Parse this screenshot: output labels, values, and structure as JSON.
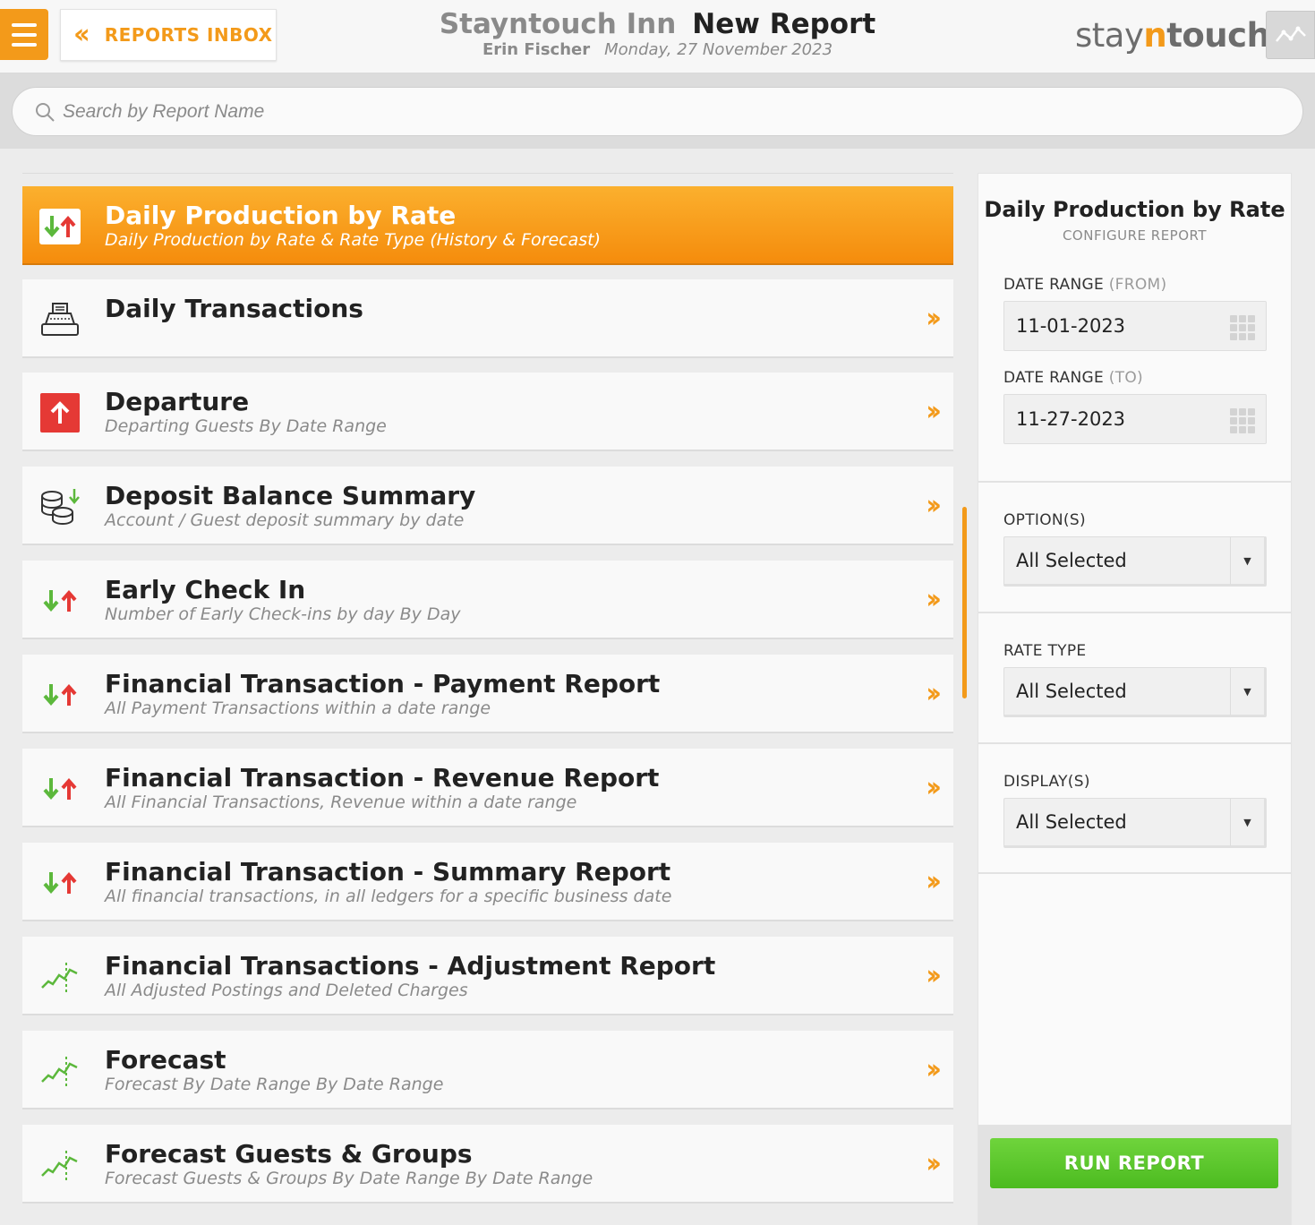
{
  "header": {
    "back_label": "REPORTS INBOX",
    "hotel_name": "Stayntouch Inn",
    "page_title": "New Report",
    "user_name": "Erin Fischer",
    "date": "Monday, 27 November 2023",
    "logo": {
      "part1": "stay",
      "part2": "n",
      "part3": "touch"
    }
  },
  "search": {
    "placeholder": "Search by Report Name"
  },
  "reports": [
    {
      "name": "Daily Production by Rate",
      "desc": "Daily Production by Rate & Rate Type (History & Forecast)",
      "icon": "arrows-icon",
      "active": true
    },
    {
      "name": "Daily Transactions",
      "desc": "",
      "icon": "cash-register-icon",
      "active": false
    },
    {
      "name": "Departure",
      "desc": "Departing Guests By Date Range",
      "icon": "departure-icon",
      "active": false
    },
    {
      "name": "Deposit Balance Summary",
      "desc": "Account / Guest deposit summary by date",
      "icon": "coins-icon",
      "active": false
    },
    {
      "name": "Early Check In",
      "desc": "Number of Early Check-ins by day By Day",
      "icon": "arrows-icon",
      "active": false
    },
    {
      "name": "Financial Transaction - Payment Report",
      "desc": "All Payment Transactions within a date range",
      "icon": "arrows-icon",
      "active": false
    },
    {
      "name": "Financial Transaction - Revenue Report",
      "desc": "All Financial Transactions, Revenue within a date range",
      "icon": "arrows-icon",
      "active": false
    },
    {
      "name": "Financial Transaction - Summary Report",
      "desc": "All financial transactions, in all ledgers for a specific business date",
      "icon": "arrows-icon",
      "active": false
    },
    {
      "name": "Financial Transactions - Adjustment Report",
      "desc": "All Adjusted Postings and Deleted Charges",
      "icon": "trend-icon",
      "active": false
    },
    {
      "name": "Forecast",
      "desc": "Forecast By Date Range By Date Range",
      "icon": "trend-icon",
      "active": false
    },
    {
      "name": "Forecast Guests & Groups",
      "desc": "Forecast Guests & Groups By Date Range By Date Range",
      "icon": "trend-icon",
      "active": false
    }
  ],
  "panel": {
    "title": "Daily Production by Rate",
    "subtitle": "CONFIGURE REPORT",
    "date_from_label": "DATE RANGE",
    "date_from_hint": "(FROM)",
    "date_from": "11-01-2023",
    "date_to_label": "DATE RANGE",
    "date_to_hint": "(TO)",
    "date_to": "11-27-2023",
    "options_label": "OPTION(S)",
    "options_value": "All Selected",
    "rate_type_label": "RATE TYPE",
    "rate_type_value": "All Selected",
    "display_label": "DISPLAY(S)",
    "display_value": "All Selected",
    "run_label": "RUN REPORT"
  },
  "colors": {
    "accent": "#f39a1a",
    "run": "#5cc72c",
    "up": "#e53935",
    "down": "#5cb83c"
  }
}
